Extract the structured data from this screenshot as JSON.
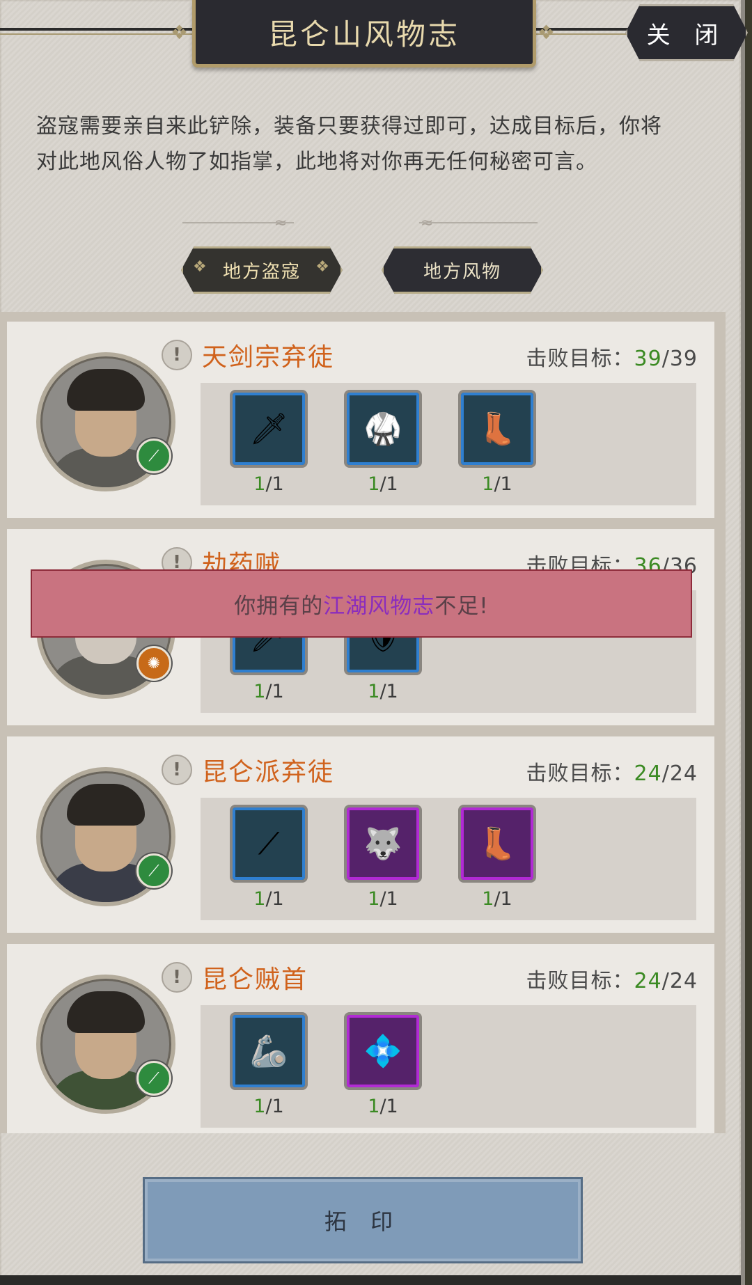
{
  "window": {
    "title": "昆仑山风物志",
    "close_label": "关 闭",
    "description": "盗寇需要亲自来此铲除，装备只要获得过即可，达成目标后，你将对此地风俗人物了如指掌，此地将对你再无任何秘密可言。"
  },
  "tabs": [
    {
      "label": "地方盗寇",
      "active": true
    },
    {
      "label": "地方风物",
      "active": false
    }
  ],
  "target_label": "击败目标：",
  "enemies": [
    {
      "name": "天剑宗弃徒",
      "defeated": "39",
      "total": "/39",
      "badge": "green",
      "items": [
        {
          "icon": "sword-icon",
          "rarity": "blue",
          "got": "1",
          "need": "/1"
        },
        {
          "icon": "robe-icon",
          "rarity": "blue",
          "got": "1",
          "need": "/1"
        },
        {
          "icon": "boots-icon",
          "rarity": "blue",
          "got": "1",
          "need": "/1"
        }
      ]
    },
    {
      "name": "劫药贼",
      "defeated": "36",
      "total": "/36",
      "badge": "orange",
      "items": [
        {
          "icon": "sword-icon",
          "rarity": "blue",
          "got": "1",
          "need": "/1"
        },
        {
          "icon": "armor-icon",
          "rarity": "blue",
          "got": "1",
          "need": "/1"
        }
      ]
    },
    {
      "name": "昆仑派弃徒",
      "defeated": "24",
      "total": "/24",
      "badge": "green",
      "items": [
        {
          "icon": "spear-icon",
          "rarity": "blue",
          "got": "1",
          "need": "/1"
        },
        {
          "icon": "beast-armor-icon",
          "rarity": "purple",
          "got": "1",
          "need": "/1"
        },
        {
          "icon": "boots-icon",
          "rarity": "purple",
          "got": "1",
          "need": "/1"
        }
      ]
    },
    {
      "name": "昆仑贼首",
      "defeated": "24",
      "total": "/24",
      "badge": "green",
      "items": [
        {
          "icon": "bracer-icon",
          "rarity": "blue",
          "got": "1",
          "need": "/1"
        },
        {
          "icon": "belt-icon",
          "rarity": "purple",
          "got": "1",
          "need": "/1"
        }
      ]
    }
  ],
  "toast": {
    "prefix": "你拥有的",
    "highlight": "江湖风物志",
    "suffix": "不足!"
  },
  "print_button": "拓 印",
  "colors": {
    "name_orange": "#d0621c",
    "progress_green": "#3b8a23",
    "rarity_blue": "#2f7fd0",
    "rarity_purple": "#b12ad4",
    "toast_bg": "#c97380"
  }
}
